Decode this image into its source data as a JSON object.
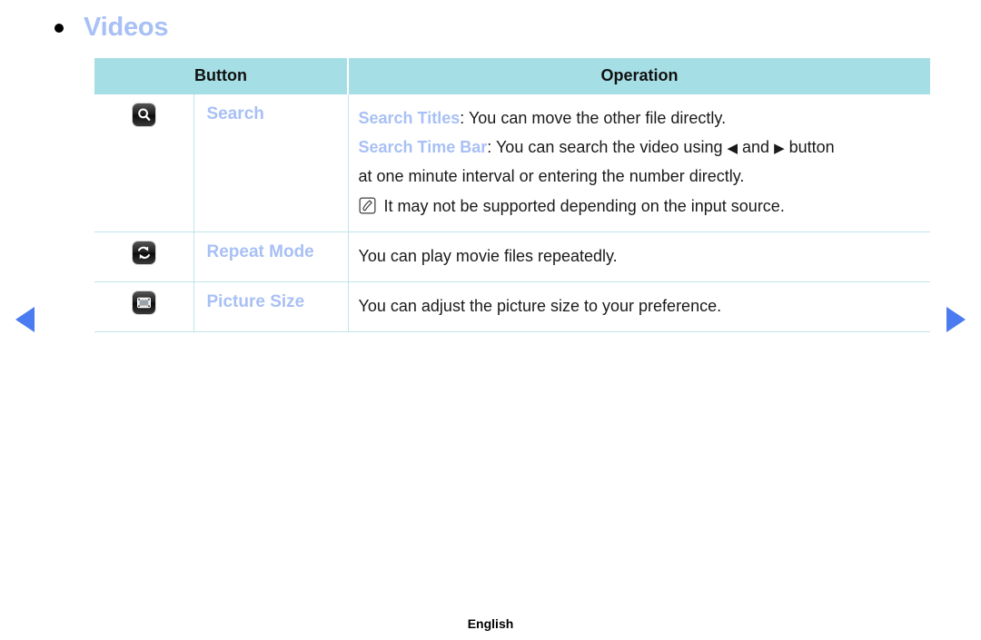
{
  "page": {
    "title": "Videos",
    "bullet_icon": "bullet-dot-icon",
    "footer_language": "English"
  },
  "nav": {
    "prev_icon": "triangle-left-icon",
    "next_icon": "triangle-right-icon"
  },
  "table": {
    "headers": {
      "button": "Button",
      "operation": "Operation"
    },
    "rows": [
      {
        "icon": "search-magnifier-icon",
        "name": "Search",
        "lines": [
          {
            "key": "Search Titles",
            "sep": ": ",
            "text": "You can move the other file directly."
          },
          {
            "key": "Search Time Bar",
            "sep": ": ",
            "text_before": "You can search the video using ",
            "tri_left": "◀",
            "text_mid": " and ",
            "tri_right": "▶",
            "text_after": " button"
          },
          {
            "text": "at one minute interval or entering the number directly."
          }
        ],
        "note": {
          "icon": "note-pen-icon",
          "text": "It may not be supported depending on the input source."
        }
      },
      {
        "icon": "repeat-loop-icon",
        "name": "Repeat Mode",
        "lines": [
          {
            "text": "You can play movie files repeatedly."
          }
        ]
      },
      {
        "icon": "picture-size-icon",
        "name": "Picture Size",
        "lines": [
          {
            "text": "You can adjust the picture size to your preference."
          }
        ]
      }
    ]
  },
  "colors": {
    "header_bg": "#a6dee5",
    "accent_label": "#a8c0f5",
    "nav_arrow": "#4a7bf0",
    "grid_line": "#bfe4e8"
  }
}
